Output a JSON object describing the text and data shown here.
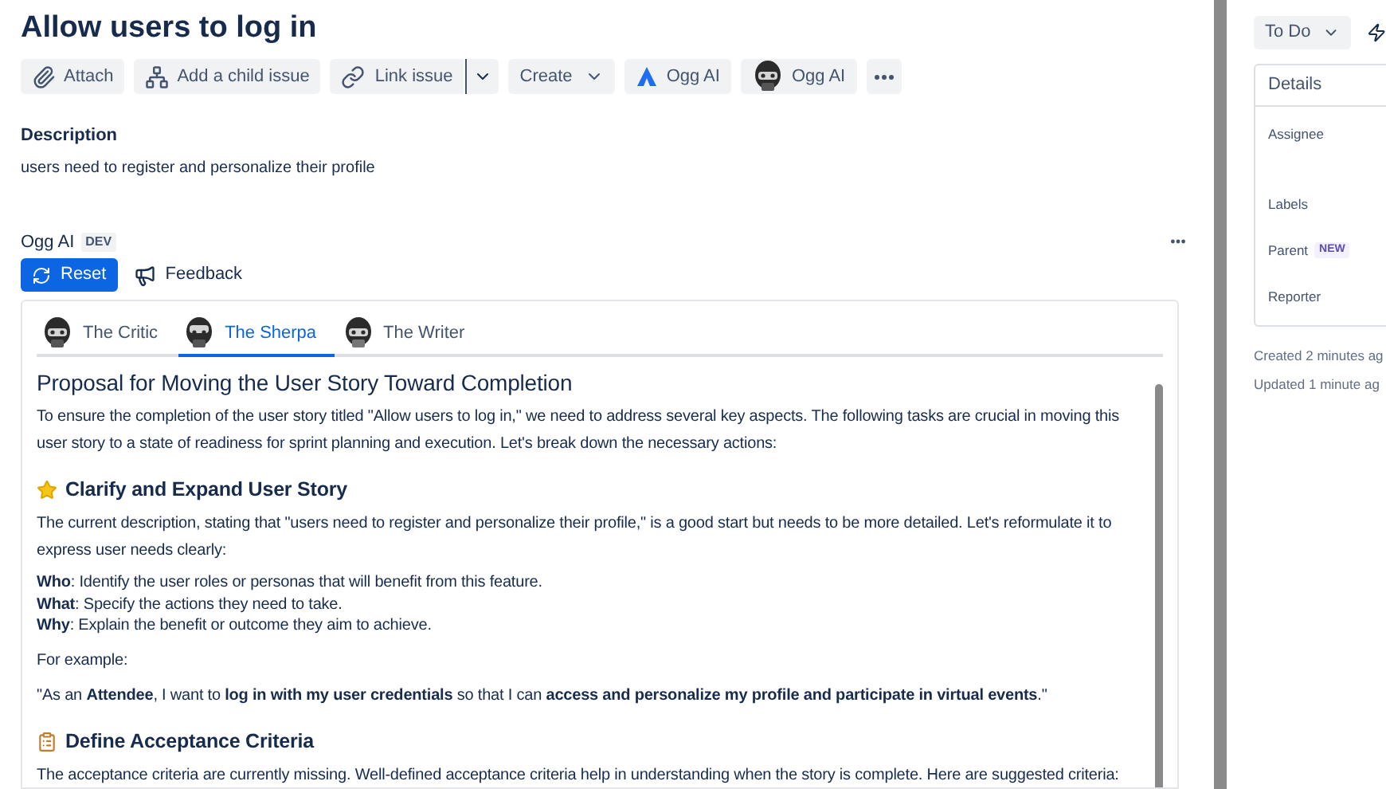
{
  "issue": {
    "title": "Allow users to log in"
  },
  "toolbar": [
    {
      "kind": "attach",
      "label": "Attach"
    },
    {
      "kind": "child",
      "label": "Add a child issue"
    },
    {
      "kind": "link",
      "label": "Link issue"
    },
    {
      "kind": "create",
      "label": "Create"
    },
    {
      "kind": "triangle",
      "label": "Ogg AI"
    },
    {
      "kind": "robot",
      "label": "Ogg AI"
    },
    {
      "kind": "more"
    }
  ],
  "description": {
    "label": "Description",
    "text": "users need to register and personalize their profile"
  },
  "ogg_ai": {
    "title": "Ogg AI",
    "badge": "DEV",
    "reset": "Reset",
    "feedback": "Feedback",
    "tabs": [
      {
        "label": "The Critic",
        "selected": false
      },
      {
        "label": "The Sherpa",
        "selected": true
      },
      {
        "label": "The Writer",
        "selected": false
      }
    ],
    "content": [
      {
        "kind": "h1",
        "text": "Proposal for Moving the User Story Toward Completion"
      },
      {
        "kind": "p",
        "text": "To ensure the completion of the user story titled \"Allow users to log in,\" we need to address several key aspects. The following tasks are crucial in moving this user story to a state of readiness for sprint planning and execution. Let's break down the necessary actions:"
      },
      {
        "kind": "star_heading",
        "text": "Clarify and Expand User Story"
      },
      {
        "kind": "p",
        "text": "The current description, stating that \"users need to register and personalize their profile,\" is a good start but needs to be more detailed. Let's reformulate it to express user needs clearly:"
      },
      {
        "kind": "lines",
        "lines": [
          "**Who**: Identify the user roles or personas that will benefit from this feature.",
          "**What**: Specify the actions they need to take.",
          "**Why**: Explain the benefit or outcome they aim to achieve."
        ]
      },
      {
        "kind": "p",
        "text": "For example:"
      },
      {
        "kind": "p",
        "text": "\"As an **Attendee**, I want to **log in with my user credentials** so that I can **access and personalize my profile and participate in virtual events**.\""
      },
      {
        "kind": "clipboard_heading",
        "text": "Define Acceptance Criteria"
      },
      {
        "kind": "p",
        "text": "The acceptance criteria are currently missing. Well-defined acceptance criteria help in understanding when the story is complete. Here are suggested criteria:"
      }
    ]
  },
  "sidebar": {
    "status": "To Do",
    "details_title": "Details",
    "fields": [
      {
        "label": "Assignee"
      },
      {
        "label": "Labels"
      },
      {
        "label": "Parent",
        "badge": "NEW"
      },
      {
        "label": "Reporter"
      }
    ],
    "created": "Created 2 minutes ag",
    "updated": "Updated 1 minute ag"
  }
}
